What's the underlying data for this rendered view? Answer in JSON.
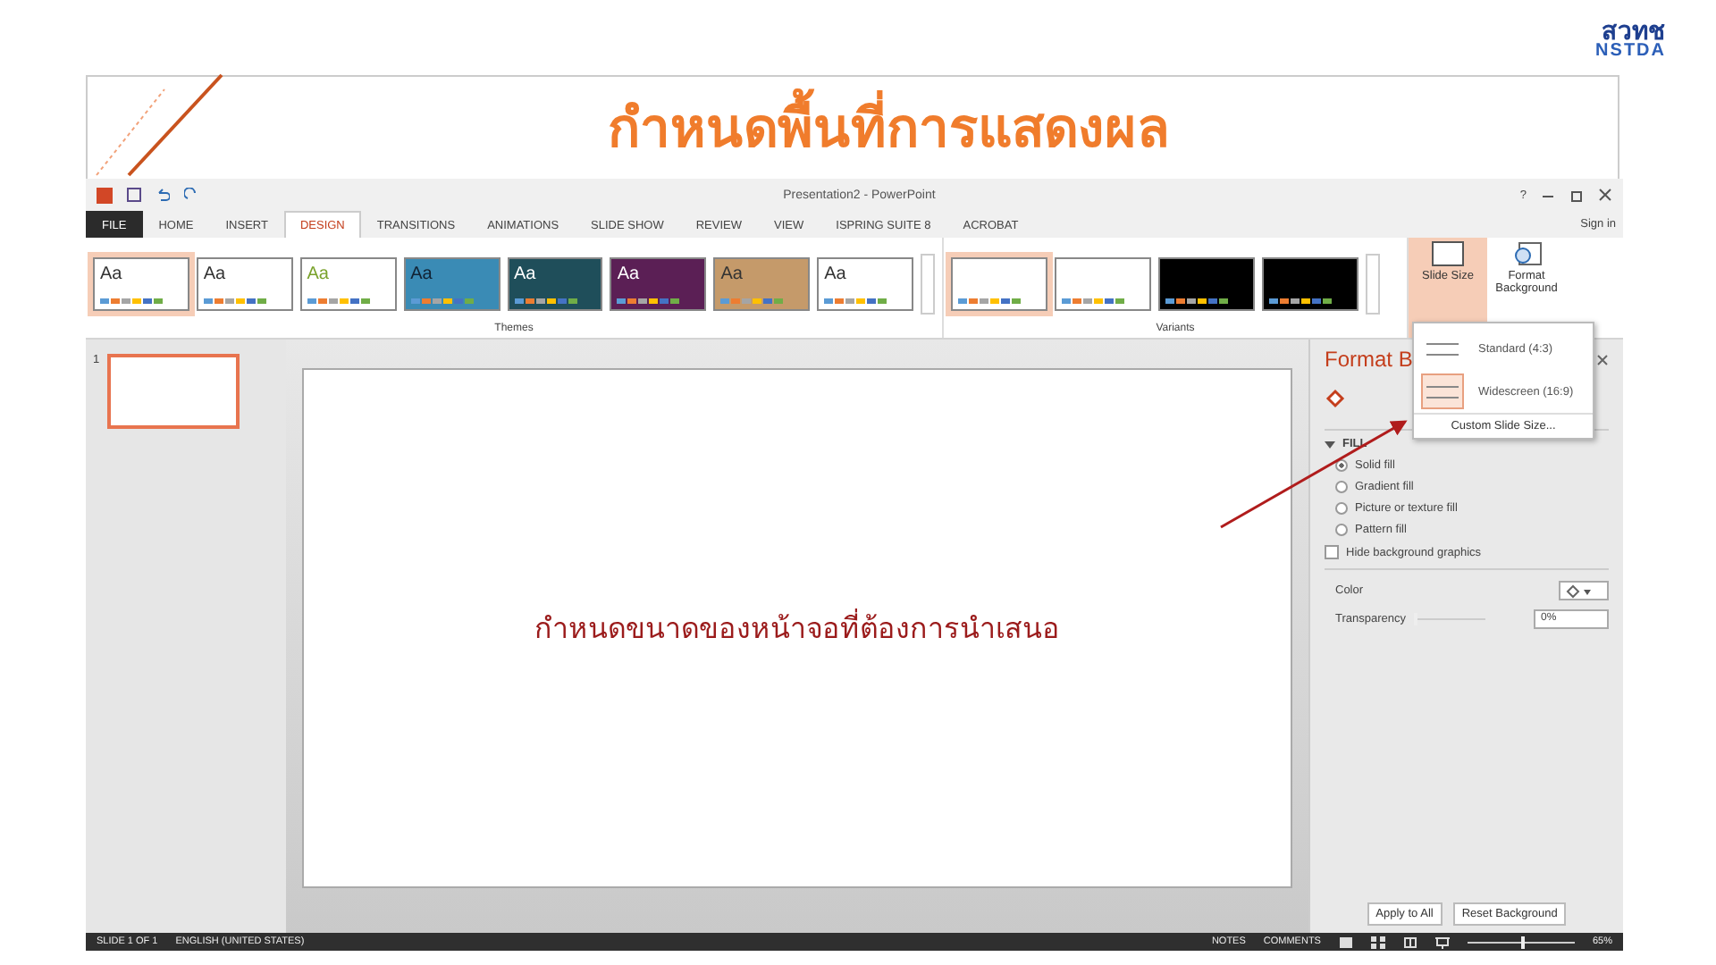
{
  "heading": {
    "title": "กำหนดพื้นที่การแสดงผล",
    "logo": {
      "thai": "สวทช",
      "latin": "NSTDA"
    }
  },
  "window": {
    "title": "Presentation2 - PowerPoint",
    "help": "?",
    "sign_in": "Sign in"
  },
  "tabs": [
    {
      "label": "FILE",
      "selected": false,
      "kind": "file"
    },
    {
      "label": "HOME",
      "selected": false,
      "kind": "tab"
    },
    {
      "label": "INSERT",
      "selected": false,
      "kind": "tab"
    },
    {
      "label": "DESIGN",
      "selected": true,
      "kind": "tab"
    },
    {
      "label": "TRANSITIONS",
      "selected": false,
      "kind": "tab"
    },
    {
      "label": "ANIMATIONS",
      "selected": false,
      "kind": "tab"
    },
    {
      "label": "SLIDE SHOW",
      "selected": false,
      "kind": "tab"
    },
    {
      "label": "REVIEW",
      "selected": false,
      "kind": "tab"
    },
    {
      "label": "VIEW",
      "selected": false,
      "kind": "tab"
    },
    {
      "label": "ISPRING SUITE 8",
      "selected": false,
      "kind": "tab"
    },
    {
      "label": "ACROBAT",
      "selected": false,
      "kind": "tab"
    }
  ],
  "themes": {
    "label": "Themes",
    "items": [
      {
        "label": "Aa",
        "selected": true
      },
      {
        "label": "Aa",
        "selected": false
      },
      {
        "label": "Aa",
        "selected": false
      },
      {
        "label": "Aa",
        "selected": false
      },
      {
        "label": "Aa",
        "selected": false
      },
      {
        "label": "Aa",
        "selected": false
      },
      {
        "label": "Aa",
        "selected": false
      },
      {
        "label": "Aa",
        "selected": false
      }
    ]
  },
  "variants": {
    "label": "Variants",
    "items": [
      {
        "selected": true
      },
      {
        "selected": false
      },
      {
        "selected": false
      },
      {
        "selected": false
      }
    ]
  },
  "customize": {
    "slide_size": "Slide Size",
    "expanded": true,
    "format_background": "Format Background"
  },
  "size_menu": {
    "items": [
      {
        "label": "Standard (4:3)",
        "selected": false
      },
      {
        "label": "Widescreen (16:9)",
        "selected": true
      }
    ],
    "custom": "Custom Slide Size..."
  },
  "thumbnails": [
    {
      "number": "1",
      "selected": true
    }
  ],
  "slide": {
    "text": "กำหนดขนาดของหน้าจอที่ต้องการนำเสนอ"
  },
  "pane": {
    "title": "Format B",
    "section": "FILL",
    "expanded": true,
    "options": [
      {
        "label": "Solid fill",
        "selected": true
      },
      {
        "label": "Gradient fill",
        "selected": false
      },
      {
        "label": "Picture or texture fill",
        "selected": false
      },
      {
        "label": "Pattern fill",
        "selected": false
      }
    ],
    "hide_graphics": {
      "label": "Hide background graphics",
      "checked": false
    },
    "color_label": "Color",
    "transparency_label": "Transparency",
    "transparency_value": "0%",
    "transparency_slider": {
      "level": 0
    },
    "buttons": [
      "Apply to All",
      "Reset Background"
    ]
  },
  "status_bar": {
    "slide": "SLIDE 1 OF 1",
    "language": "ENGLISH (UNITED STATES)",
    "notes": "NOTES",
    "comments": "COMMENTS",
    "zoom": "65%",
    "zoom_slider": {
      "level": 0.5
    }
  }
}
